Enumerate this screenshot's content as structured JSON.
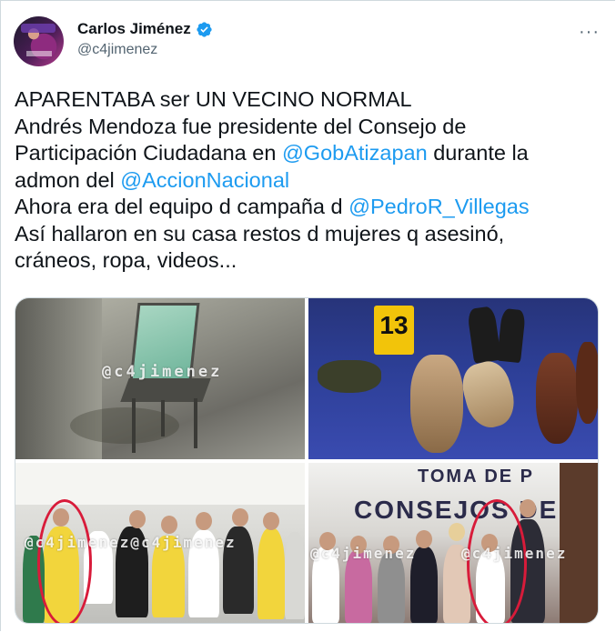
{
  "author": {
    "display_name": "Carlos Jiménez",
    "handle": "@c4jimenez",
    "verified": true,
    "avatar_icon": "profile-avatar"
  },
  "more_menu": "···",
  "tweet": {
    "line1": "APARENTABA ser UN VECINO NORMAL",
    "line2": "Andrés Mendoza fue presidente del Consejo de",
    "line3_pre": "Participación Ciudadana en ",
    "mention_gob": "@GobAtizapan",
    "line3_post": " durante la",
    "line4_pre": "admon del ",
    "mention_pan": "@AccionNacional",
    "line5_pre": "Ahora era del equipo d campaña d ",
    "mention_pedro": "@PedroR_Villegas",
    "line6": "Así hallaron en su casa restos d mujeres q asesinó,",
    "line7": "cráneos, ropa, videos..."
  },
  "media": {
    "watermark": "@c4jimenez",
    "watermark_long": "@c4jimenez@c4jimenez",
    "evidence_marker": "13",
    "banner_line1": "TOMA DE P",
    "banner_line2": "CONSEJOS DE",
    "accent_circle_color": "#d81b3a",
    "mention_color": "#1d9bf0"
  }
}
